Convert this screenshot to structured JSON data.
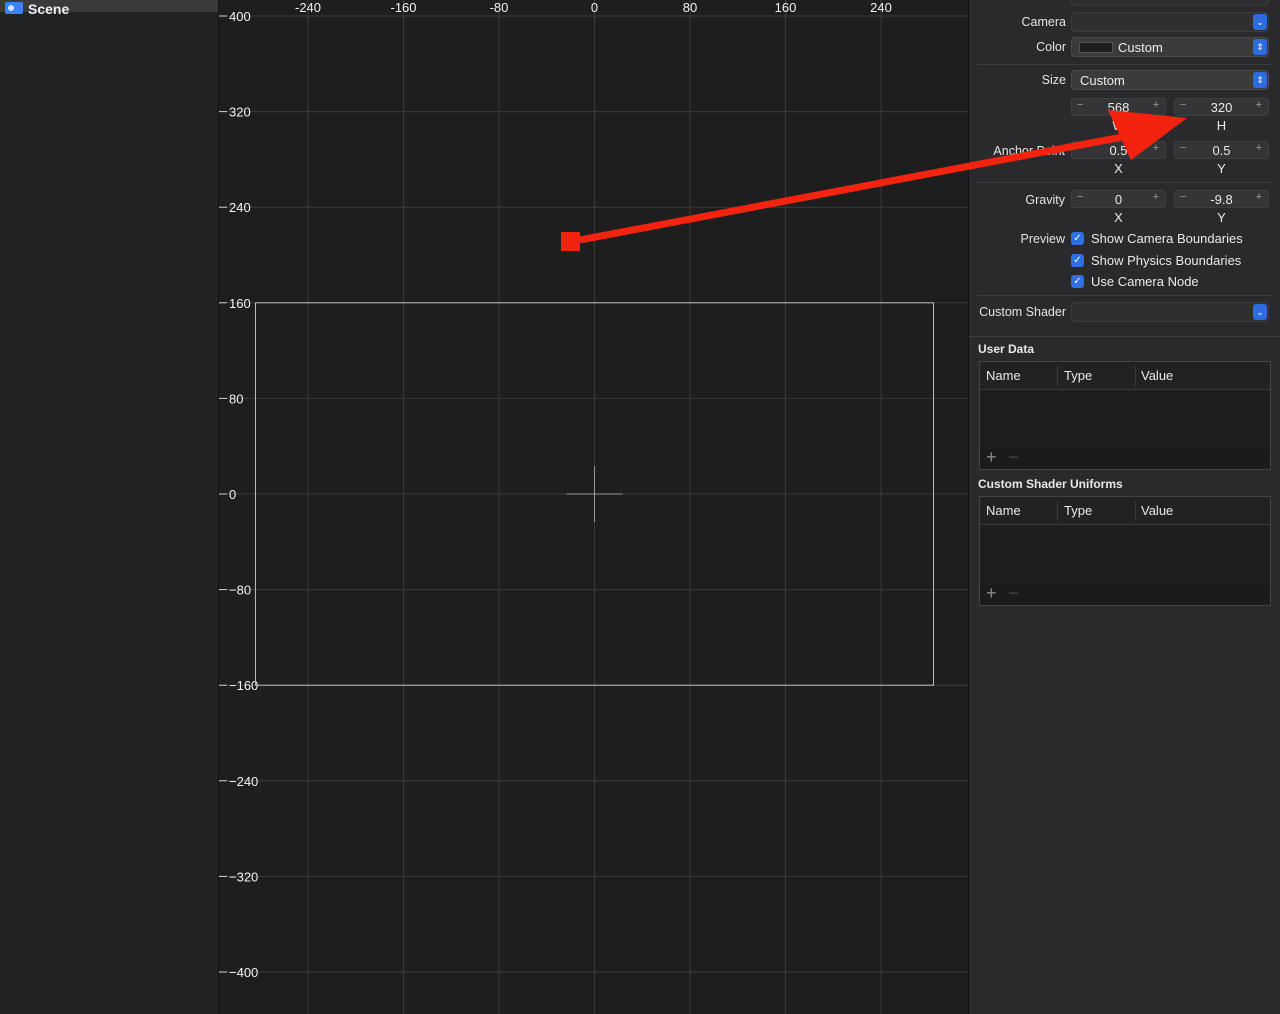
{
  "navigator": {
    "scene_label": "Scene"
  },
  "editor": {
    "x_ticks": [
      "-240",
      "-160",
      "-80",
      "0",
      "80",
      "160",
      "240"
    ],
    "y_ticks": [
      "-400",
      "-320",
      "-240",
      "-160",
      "-80",
      "0",
      "80",
      "160",
      "240",
      "320",
      "400"
    ],
    "y_tick_labels_top_to_bottom": [
      "400",
      "320",
      "240",
      "160",
      "80",
      "0",
      "−80",
      "−160",
      "−240",
      "−320",
      "−400"
    ]
  },
  "inspector": {
    "camera": {
      "label": "Camera",
      "value": ""
    },
    "color": {
      "label": "Color",
      "value": "Custom"
    },
    "size": {
      "label": "Size",
      "value": "Custom",
      "width": "568",
      "height": "320",
      "width_caption": "W",
      "height_caption": "H"
    },
    "anchor": {
      "label": "Anchor Point",
      "x": "0.5",
      "y": "0.5",
      "x_caption": "X",
      "y_caption": "Y"
    },
    "gravity": {
      "label": "Gravity",
      "x": "0",
      "y": "-9.8",
      "x_caption": "X",
      "y_caption": "Y"
    },
    "preview": {
      "label": "Preview",
      "options": [
        {
          "label": "Show Camera Boundaries",
          "checked": true
        },
        {
          "label": "Show Physics Boundaries",
          "checked": true
        },
        {
          "label": "Use Camera Node",
          "checked": true
        }
      ]
    },
    "custom_shader": {
      "label": "Custom Shader",
      "value": ""
    },
    "user_data": {
      "title": "User Data",
      "columns": [
        "Name",
        "Type",
        "Value"
      ]
    },
    "shader_uniforms": {
      "title": "Custom Shader Uniforms",
      "columns": [
        "Name",
        "Type",
        "Value"
      ]
    },
    "stepper_minus": "−",
    "stepper_plus": "+",
    "table_add": "+",
    "table_remove": "−"
  },
  "colors": {
    "accent": "#2d6ce0",
    "annotation_arrow": "#f4230f",
    "grid": "#3a3a3a",
    "boundary": "#bdbdbd"
  }
}
